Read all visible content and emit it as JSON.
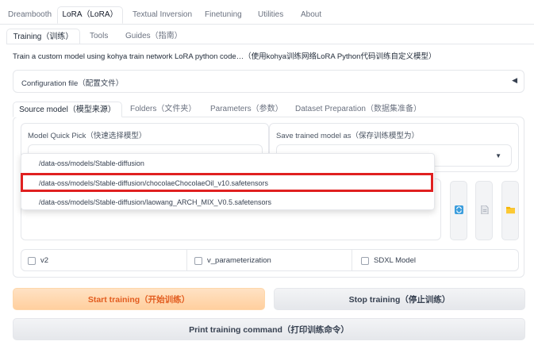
{
  "top_tabs": [
    "Dreambooth",
    "LoRA（LoRA）",
    "Textual Inversion",
    "Finetuning",
    "Utilities",
    "About"
  ],
  "lora_tabs": [
    "Training（训练）",
    "Tools",
    "Guides（指南）"
  ],
  "description": "Train a custom model using kohya train network LoRA python code…（使用kohya训练网络LoRA Python代码训练自定义模型）",
  "config": {
    "label": "Configuration file（配置文件）",
    "arrow": "◀"
  },
  "section_tabs": [
    "Source model（模型来源）",
    "Folders（文件夹）",
    "Parameters（参数）",
    "Dataset Preparation（数据集准备）"
  ],
  "model_quick_pick": {
    "label": "Model Quick Pick（快速选择模型）",
    "value": ""
  },
  "save_as": {
    "label": "Save trained model as（保存训练模型为）",
    "value": "",
    "caret": "▼"
  },
  "dropdown_options": [
    "/data-oss/models/Stable-diffusion",
    "/data-oss/models/Stable-diffusion/chocolaeChocolaeOil_v10.safetensors",
    "/data-oss/models/Stable-diffusion/laowang_ARCH_MIX_V0.5.safetensors"
  ],
  "checkboxes": [
    "v2",
    "v_parameterization",
    "SDXL Model"
  ],
  "buttons": {
    "start": "Start training（开始训练）",
    "stop": "Stop training（停止训练）",
    "print": "Print training command（打印训练命令）"
  },
  "colors": {
    "accent": "#e25c1f",
    "highlight": "#e02020"
  }
}
